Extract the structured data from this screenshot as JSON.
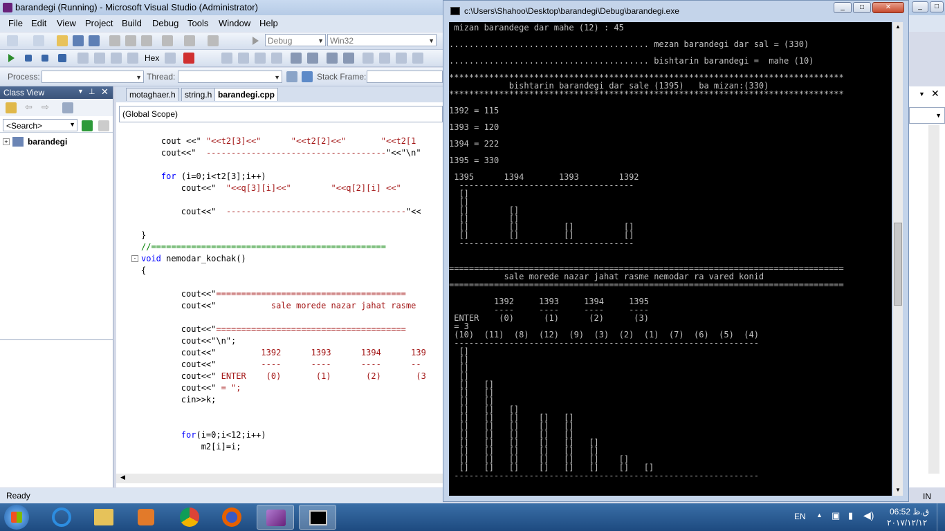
{
  "vs": {
    "title": "barandegi (Running) - Microsoft Visual Studio (Administrator)",
    "menu": [
      "File",
      "Edit",
      "View",
      "Project",
      "Build",
      "Debug",
      "Tools",
      "Window",
      "Help"
    ],
    "config_combo": "Debug",
    "platform_combo": "Win32",
    "hex_label": "Hex",
    "process_label": "Process:",
    "thread_label": "Thread:",
    "stack_frame_label": "Stack Frame:",
    "status": "Ready"
  },
  "class_view": {
    "title": "Class View",
    "search_placeholder": "<Search>",
    "tree_root": "barandegi"
  },
  "editor": {
    "tabs": [
      "motaghaer.h",
      "string.h",
      "barandegi.cpp"
    ],
    "scope": "(Global Scope)",
    "lines": [
      {
        "indent": "    ",
        "parts": [
          [
            "cout <<\" ",
            ""
          ],
          [
            "\"<<t2[3]<<\"      \"<<t2[2]<<\"       \"<<t2[1",
            "str"
          ]
        ]
      },
      {
        "indent": "    ",
        "parts": [
          [
            "cout<<\"  ",
            ""
          ],
          [
            "------------------------------------",
            "str"
          ],
          [
            "\"<<\"\\n\"",
            ""
          ]
        ]
      },
      {
        "indent": "",
        "parts": [
          [
            "",
            ""
          ]
        ]
      },
      {
        "indent": "    ",
        "parts": [
          [
            "for",
            "kw"
          ],
          [
            " (i=0;i<t2[3];i++)",
            ""
          ]
        ]
      },
      {
        "indent": "        ",
        "parts": [
          [
            "cout<<\"  ",
            ""
          ],
          [
            "\"<<q[3][i]<<\"        \"<<q[2][i] <<\"",
            "str"
          ]
        ]
      },
      {
        "indent": "",
        "parts": [
          [
            "",
            ""
          ]
        ]
      },
      {
        "indent": "        ",
        "parts": [
          [
            "cout<<\"  ",
            ""
          ],
          [
            "------------------------------------",
            "str"
          ],
          [
            "\"<<",
            ""
          ]
        ]
      },
      {
        "indent": "",
        "parts": [
          [
            "",
            ""
          ]
        ]
      },
      {
        "indent": "",
        "parts": [
          [
            "}",
            ""
          ]
        ]
      },
      {
        "indent": "",
        "parts": [
          [
            "//===============================================",
            "cm"
          ]
        ]
      },
      {
        "indent": "",
        "parts": [
          [
            "void",
            "kw"
          ],
          [
            " nemodar_kochak()",
            ""
          ]
        ]
      },
      {
        "indent": "",
        "parts": [
          [
            "{",
            ""
          ]
        ]
      },
      {
        "indent": "",
        "parts": [
          [
            "",
            ""
          ]
        ]
      },
      {
        "indent": "        ",
        "parts": [
          [
            "cout<<\"",
            ""
          ],
          [
            "======================================",
            "str"
          ]
        ]
      },
      {
        "indent": "        ",
        "parts": [
          [
            "cout<<\"",
            ""
          ],
          [
            "           sale morede nazar jahat rasme",
            "str"
          ]
        ]
      },
      {
        "indent": "",
        "parts": [
          [
            "",
            ""
          ]
        ]
      },
      {
        "indent": "        ",
        "parts": [
          [
            "cout<<\"",
            ""
          ],
          [
            "======================================",
            "str"
          ]
        ]
      },
      {
        "indent": "        ",
        "parts": [
          [
            "cout<<\"\\n\";",
            ""
          ]
        ]
      },
      {
        "indent": "        ",
        "parts": [
          [
            "cout<<\"",
            ""
          ],
          [
            "         1392      1393      1394      139",
            "str"
          ]
        ]
      },
      {
        "indent": "        ",
        "parts": [
          [
            "cout<<\"",
            ""
          ],
          [
            "         ----      ----      ----      --",
            "str"
          ]
        ]
      },
      {
        "indent": "        ",
        "parts": [
          [
            "cout<<\"",
            ""
          ],
          [
            " ENTER    (0)       (1)       (2)       (3",
            "str"
          ]
        ]
      },
      {
        "indent": "        ",
        "parts": [
          [
            "cout<<\"",
            ""
          ],
          [
            " = \";",
            "str"
          ]
        ]
      },
      {
        "indent": "        ",
        "parts": [
          [
            "cin>>k;",
            ""
          ]
        ]
      },
      {
        "indent": "",
        "parts": [
          [
            "",
            ""
          ]
        ]
      },
      {
        "indent": "",
        "parts": [
          [
            "",
            ""
          ]
        ]
      },
      {
        "indent": "        ",
        "parts": [
          [
            "for",
            "kw"
          ],
          [
            "(i=0;i<12;i++)",
            ""
          ]
        ]
      },
      {
        "indent": "            ",
        "parts": [
          [
            "m2[i]=i;",
            ""
          ]
        ]
      }
    ]
  },
  "console": {
    "title": "c:\\Users\\Shahoo\\Desktop\\barandegi\\Debug\\barandegi.exe",
    "lines": [
      " mizan barandege dar mahe (12) : 45",
      "",
      "........................................ mezan barandegi dar sal = (330)",
      "",
      "........................................ bishtarin barandegi =  mahe (10)",
      "",
      "*******************************************************************************",
      "            bishtarin barandegi dar sale (1395)   ba mizan:(330)",
      "*******************************************************************************",
      "",
      "1392 = 115",
      "",
      "1393 = 120",
      "",
      "1394 = 222",
      "",
      "1395 = 330",
      "",
      " 1395      1394       1393        1392",
      "  -----------------------------------",
      "  []",
      "  []",
      "  []        []",
      "  []        []",
      "  []        []         []          []",
      "  []        []         []          []",
      "  -----------------------------------",
      "",
      "",
      "===============================================================================",
      "           sale morede nazar jahat rasme nemodar ra vared konid",
      "===============================================================================",
      "",
      "         1392     1393     1394     1395",
      "         ----     ----     ----     ----",
      " ENTER    (0)      (1)      (2)      (3)",
      " = 3",
      " (10)  (11)  (8)  (12)  (9)  (3)  (2)  (1)  (7)  (6)  (5)  (4)",
      " -------------------------------------------------------------",
      "  []",
      "  []",
      "  []",
      "  []",
      "  []   []",
      "  []   []",
      "  []   []",
      "  []   []   []",
      "  []   []   []    []   []",
      "  []   []   []    []   []",
      "  []   []   []    []   []",
      "  []   []   []    []   []   []",
      "  []   []   []    []   []   []",
      "  []   []   []    []   []   []    []",
      "  []   []   []    []   []   []    []   []",
      " -------------------------------------------------------------"
    ]
  },
  "taskbar": {
    "lang": "EN",
    "time": "06:52 ق.ظ",
    "date": "۲۰۱۷/۱۲/۱۲",
    "status_right": "IN"
  }
}
